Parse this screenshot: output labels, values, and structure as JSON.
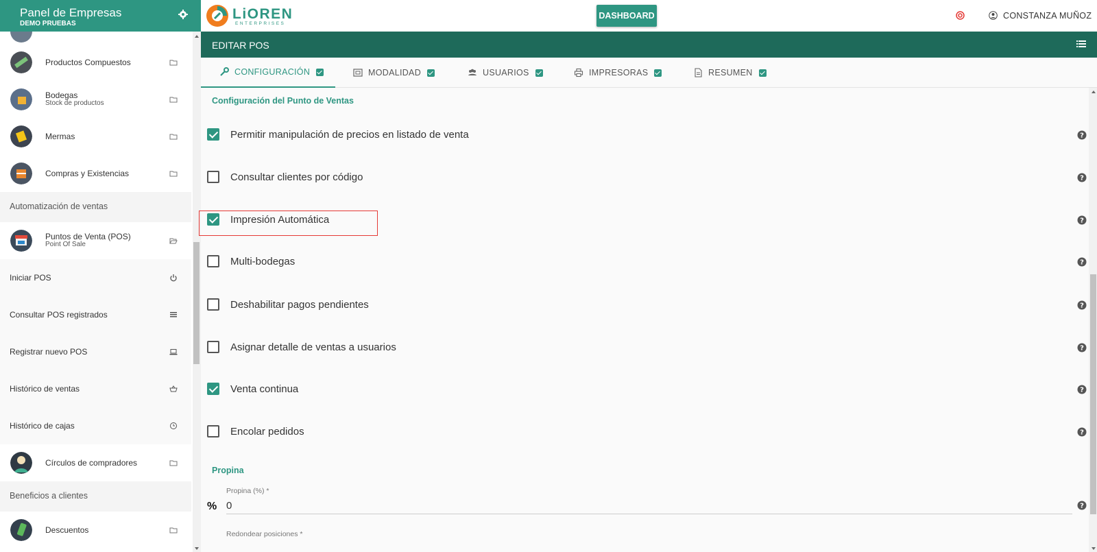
{
  "sidebar": {
    "title": "Panel de Empresas",
    "subtitle": "DEMO PRUEBAS",
    "items": [
      {
        "label": "Productos Compuestos",
        "sub": ""
      },
      {
        "label": "Bodegas",
        "sub": "Stock de productos"
      },
      {
        "label": "Mermas",
        "sub": ""
      },
      {
        "label": "Compras y Existencias",
        "sub": ""
      }
    ],
    "section1": "Automatización de ventas",
    "pos_item": {
      "label": "Puntos de Venta (POS)",
      "sub": "Point Of Sale"
    },
    "sub_items": [
      {
        "label": "Iniciar POS",
        "icon": "power-icon"
      },
      {
        "label": "Consultar POS registrados",
        "icon": "list-icon"
      },
      {
        "label": "Registrar nuevo POS",
        "icon": "laptop-icon"
      },
      {
        "label": "Histórico de ventas",
        "icon": "basket-icon"
      },
      {
        "label": "Histórico de cajas",
        "icon": "clock-icon"
      }
    ],
    "circulos": {
      "label": "Círculos de compradores"
    },
    "section2": "Beneficios a clientes",
    "descuentos": {
      "label": "Descuentos"
    }
  },
  "topbar": {
    "logo_text": "LiOREN",
    "logo_sub": "ENTERPRISES",
    "dashboard_label": "DASHBOARD",
    "user_name": "CONSTANZA MUÑOZ"
  },
  "edit_header": {
    "title": "EDITAR POS"
  },
  "tabs": [
    {
      "label": "CONFIGURACIÓN",
      "icon": "wrench-icon",
      "active": true
    },
    {
      "label": "MODALIDAD",
      "icon": "frame-icon",
      "active": false
    },
    {
      "label": "USUARIOS",
      "icon": "users-icon",
      "active": false
    },
    {
      "label": "IMPRESORAS",
      "icon": "printer-icon",
      "active": false
    },
    {
      "label": "RESUMEN",
      "icon": "document-icon",
      "active": false
    }
  ],
  "config": {
    "section_title": "Configuración del Punto de Ventas",
    "options": [
      {
        "label": "Permitir manipulación de precios en listado de venta",
        "checked": true
      },
      {
        "label": "Consultar clientes por código",
        "checked": false
      },
      {
        "label": "Impresión Automática",
        "checked": true
      },
      {
        "label": "Multi-bodegas",
        "checked": false
      },
      {
        "label": "Deshabilitar pagos pendientes",
        "checked": false
      },
      {
        "label": "Asignar detalle de ventas a usuarios",
        "checked": false
      },
      {
        "label": "Venta continua",
        "checked": true
      },
      {
        "label": "Encolar pedidos",
        "checked": false
      }
    ]
  },
  "propina": {
    "section_title": "Propina",
    "field_label": "Propina (%) *",
    "value": "0",
    "symbol": "%",
    "next_label": "Redondear posiciones *"
  },
  "colors": {
    "primary": "#2e9682",
    "dark": "#1e6a5a",
    "highlight": "#e53935"
  }
}
